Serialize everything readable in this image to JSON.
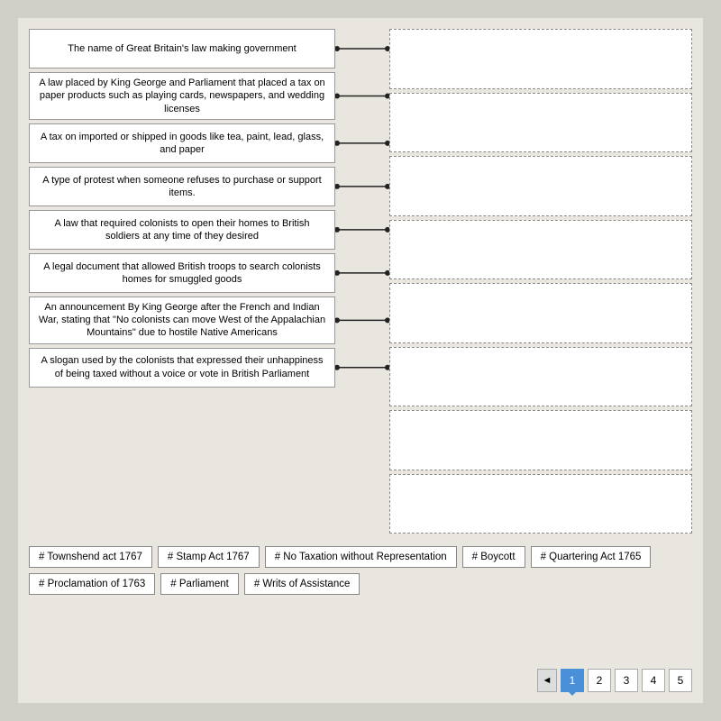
{
  "left_items": [
    {
      "id": "l1",
      "text": "The name of Great Britain's law making government"
    },
    {
      "id": "l2",
      "text": "A law placed by King George and Parliament that placed a tax on paper products such as playing cards, newspapers, and wedding licenses"
    },
    {
      "id": "l3",
      "text": "A tax on imported or shipped in goods like tea, paint, lead, glass, and paper"
    },
    {
      "id": "l4",
      "text": "A type of protest when someone refuses to purchase or support items."
    },
    {
      "id": "l5",
      "text": "A law that required colonists to open their homes to British soldiers at any time of they desired"
    },
    {
      "id": "l6",
      "text": "A legal document that allowed British troops to search colonists homes for smuggled goods"
    },
    {
      "id": "l7",
      "text": "An announcement By King George after the French and Indian War, stating that \"No colonists can move West of the Appalachian Mountains\" due to hostile Native Americans"
    },
    {
      "id": "l8",
      "text": "A slogan used by the colonists that expressed their unhappiness of being taxed without a voice or vote in British Parliament"
    }
  ],
  "word_bank": [
    {
      "id": "w1",
      "label": "# Townshend act 1767"
    },
    {
      "id": "w2",
      "label": "# Stamp Act 1767"
    },
    {
      "id": "w3",
      "label": "# No Taxation without Representation"
    },
    {
      "id": "w4",
      "label": "# Boycott"
    },
    {
      "id": "w5",
      "label": "# Quartering Act 1765"
    },
    {
      "id": "w6",
      "label": "# Proclamation of 1763"
    },
    {
      "id": "w7",
      "label": "# Parliament"
    },
    {
      "id": "w8",
      "label": "# Writs of Assistance"
    }
  ],
  "pagination": {
    "prev_label": "◄",
    "pages": [
      "1",
      "2",
      "3",
      "4",
      "5"
    ]
  }
}
